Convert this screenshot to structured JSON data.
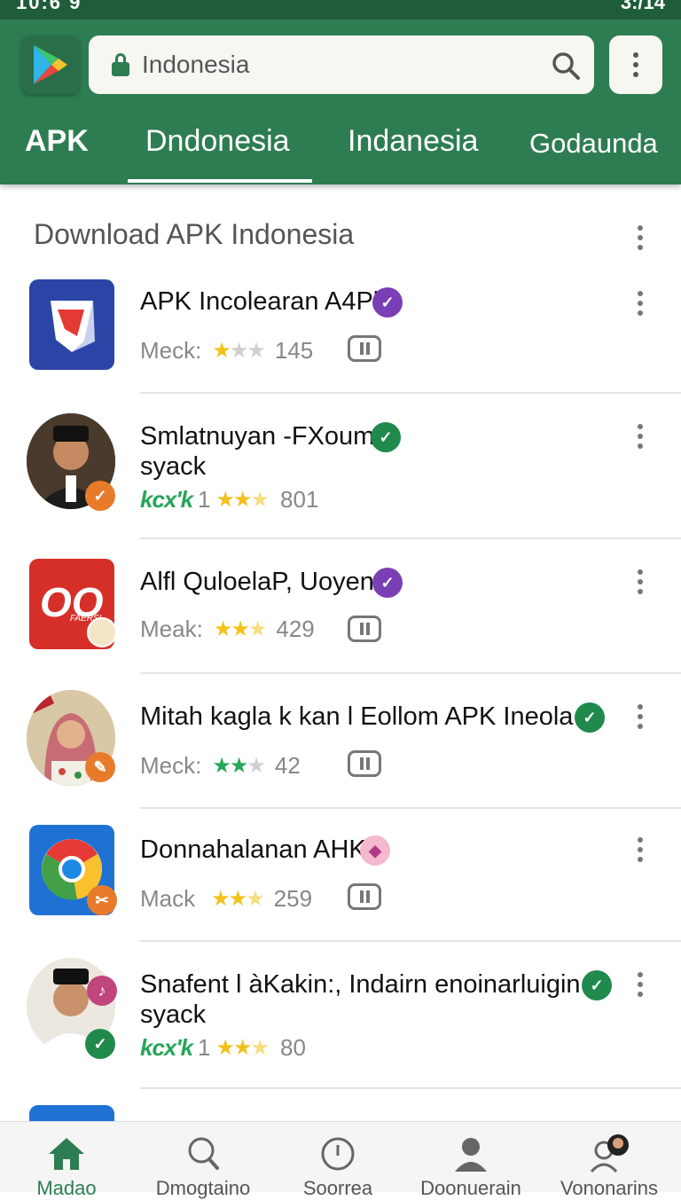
{
  "status_bar": {
    "time_left": "10:6 9",
    "time_right": "3:/14"
  },
  "search": {
    "value": "Indonesia"
  },
  "tabs": [
    {
      "label": "APK"
    },
    {
      "label": "Dndonesia"
    },
    {
      "label": "Indanesia"
    },
    {
      "label": "Godaunda"
    }
  ],
  "section": {
    "title": "Download APK Indonesia"
  },
  "items": [
    {
      "title": "APK Incolearan A4Pl",
      "meta_label": "Meck:",
      "rating": "1.5",
      "count": "145",
      "verified_color": "#7b3fb5"
    },
    {
      "title": "Smlatnuyan -FXoum",
      "subtitle": "syack",
      "tag": "kcx'k",
      "tag_num": "1",
      "rating": "2.5",
      "count": "801",
      "verified_color": "#1f8a4c"
    },
    {
      "title": "Alfl QuloelaP, Uoyen",
      "logo_text": "OO",
      "logo_sub": "FAERSI",
      "meta_label": "Meak:",
      "rating": "2.5",
      "count": "429",
      "verified_color": "#7b3fb5"
    },
    {
      "title": "Mitah kagla k kan l Eollom APK Ineola",
      "meta_label": "Meck:",
      "rating": "2",
      "count": "42",
      "verified_color": "#1f8a4c"
    },
    {
      "title": "Donnahalanan AHK",
      "meta_label": "Mack",
      "rating": "2.5",
      "count": "259",
      "verified_color": "#e86aa4"
    },
    {
      "title": "Snafent l àKakin:, Indairn enoinarluigin",
      "subtitle": "syack",
      "tag": "kcx'k",
      "tag_num": "1",
      "rating": "2.5",
      "count": "80",
      "verified_color": "#1f8a4c"
    }
  ],
  "bottom_nav": [
    {
      "label": "Madao",
      "icon": "home-icon"
    },
    {
      "label": "Dmogtaino",
      "icon": "search-person-icon"
    },
    {
      "label": "Soorrea",
      "icon": "clock-icon"
    },
    {
      "label": "Doonuerain",
      "icon": "person-icon"
    },
    {
      "label": "Vononarins",
      "icon": "account-icon"
    }
  ],
  "colors": {
    "header": "#2e7d52",
    "accent": "#27a559",
    "star": "#f2c21b"
  }
}
